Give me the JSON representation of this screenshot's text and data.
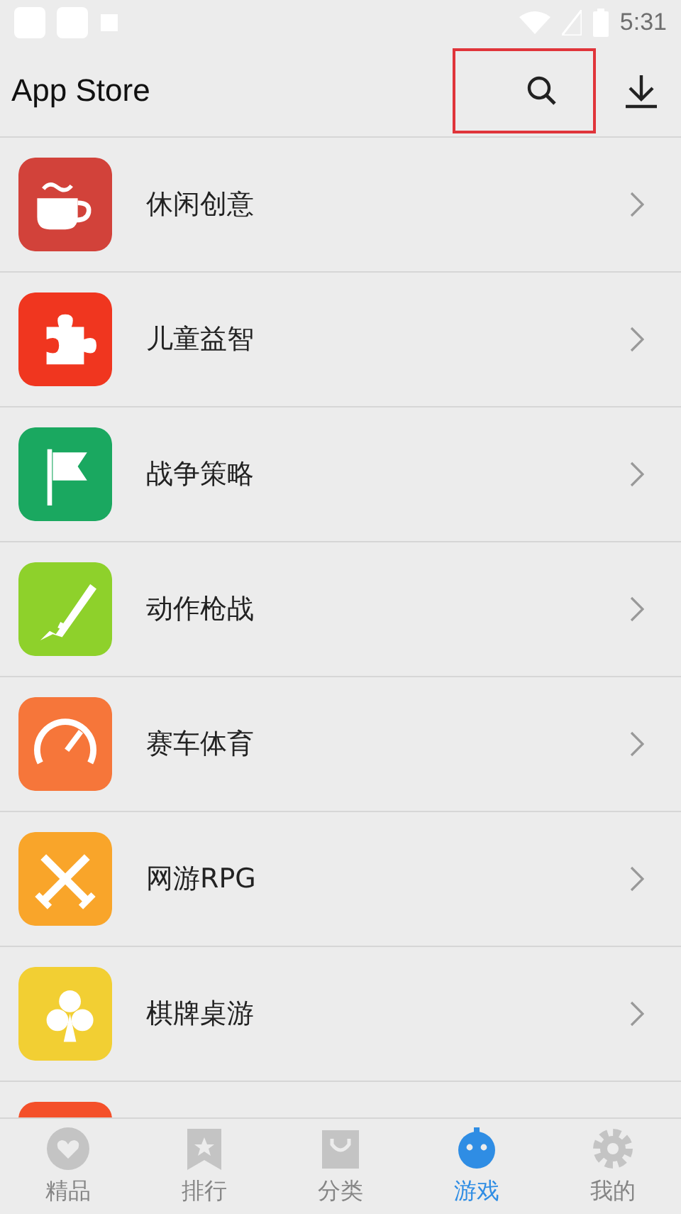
{
  "status_bar": {
    "time": "5:31"
  },
  "header": {
    "title": "App Store",
    "search": {
      "highlighted": true
    }
  },
  "categories": [
    {
      "label": "休闲创意",
      "color": "#d2423a"
    },
    {
      "label": "儿童益智",
      "color": "#f0361f"
    },
    {
      "label": "战争策略",
      "color": "#1aa860"
    },
    {
      "label": "动作枪战",
      "color": "#8ed12b"
    },
    {
      "label": "赛车体育",
      "color": "#f6763a"
    },
    {
      "label": "网游RPG",
      "color": "#f9a52a"
    },
    {
      "label": "棋牌桌游",
      "color": "#f2cf33"
    },
    {
      "color": "#f4502a"
    }
  ],
  "tab_bar": [
    {
      "label": "精品",
      "selected": false
    },
    {
      "label": "排行",
      "selected": false
    },
    {
      "label": "分类",
      "selected": false
    },
    {
      "label": "游戏",
      "selected": true
    },
    {
      "label": "我的",
      "selected": false
    }
  ]
}
